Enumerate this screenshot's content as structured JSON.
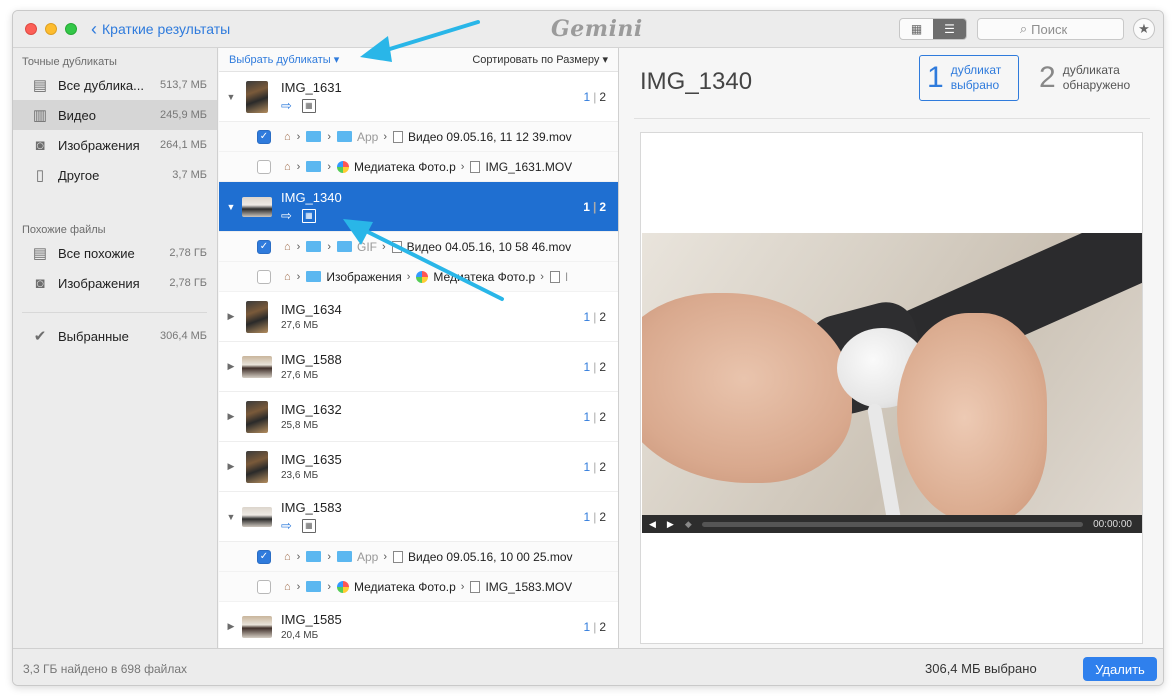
{
  "titlebar": {
    "back_label": "Краткие результаты",
    "app_name": "Gemini",
    "search_placeholder": "Поиск"
  },
  "sidebar": {
    "exact_title": "Точные дубликаты",
    "exact_items": [
      {
        "label": "Все дублика...",
        "size": "513,7 МБ",
        "icon": "stack-icon"
      },
      {
        "label": "Видео",
        "size": "245,9 МБ",
        "icon": "film-icon"
      },
      {
        "label": "Изображения",
        "size": "264,1 МБ",
        "icon": "camera-icon"
      },
      {
        "label": "Другое",
        "size": "3,7 МБ",
        "icon": "document-icon"
      }
    ],
    "similar_title": "Похожие файлы",
    "similar_items": [
      {
        "label": "Все похожие",
        "size": "2,78 ГБ",
        "icon": "stack-icon"
      },
      {
        "label": "Изображения",
        "size": "2,78 ГБ",
        "icon": "camera-icon"
      }
    ],
    "selected_item": {
      "label": "Выбранные",
      "size": "306,4 МБ",
      "icon": "check-circle-icon"
    }
  },
  "list": {
    "select_duplicates": "Выбрать дубликаты",
    "sort_label": "Сортировать по Размеру",
    "groups": [
      {
        "name": "IMG_1631",
        "selected_count": "1",
        "total": "2"
      },
      {
        "name": "IMG_1340",
        "selected_count": "1",
        "total": "2"
      },
      {
        "name": "IMG_1634",
        "size": "27,6 МБ",
        "selected_count": "1",
        "total": "2"
      },
      {
        "name": "IMG_1588",
        "size": "27,6 МБ",
        "selected_count": "1",
        "total": "2"
      },
      {
        "name": "IMG_1632",
        "size": "25,8 МБ",
        "selected_count": "1",
        "total": "2"
      },
      {
        "name": "IMG_1635",
        "size": "23,6 МБ",
        "selected_count": "1",
        "total": "2"
      },
      {
        "name": "IMG_1583",
        "selected_count": "1",
        "total": "2"
      },
      {
        "name": "IMG_1585",
        "size": "20,4 МБ",
        "selected_count": "1",
        "total": "2"
      }
    ],
    "files": {
      "g1631_a": {
        "folder": "App",
        "file": "Видео 09.05.16, 11 12 39.mov"
      },
      "g1631_b": {
        "folder": "Медиатека Фото.p",
        "file": "IMG_1631.MOV"
      },
      "g1340_a": {
        "folder": "GIF",
        "file": "Видео 04.05.16, 10 58 46.mov"
      },
      "g1340_b": {
        "folder": "Изображения",
        "library": "Медиатека Фото.p",
        "file": "I"
      },
      "g1583_a": {
        "folder": "App",
        "file": "Видео 09.05.16, 10 00 25.mov"
      },
      "g1583_b": {
        "folder": "Медиатека Фото.p",
        "file": "IMG_1583.MOV"
      }
    }
  },
  "preview": {
    "title": "IMG_1340",
    "selected_num": "1",
    "selected_label_1": "дубликат",
    "selected_label_2": "выбрано",
    "found_num": "2",
    "found_label_1": "дубликата",
    "found_label_2": "обнаружено",
    "time": "00:00:00"
  },
  "footer": {
    "found_text": "3,3 ГБ найдено в 698 файлах",
    "selected_text": "306,4 МБ выбрано",
    "delete_label": "Удалить"
  },
  "colors": {
    "accent": "#2f7bdc",
    "selection": "#1f6fd1",
    "annotation_arrow": "#29b6e8"
  }
}
